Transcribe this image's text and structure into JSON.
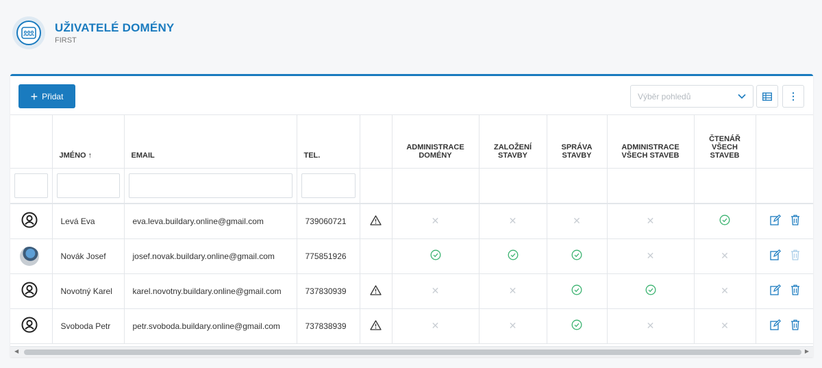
{
  "header": {
    "title": "UŽIVATELÉ DOMÉNY",
    "subtitle": "FIRST",
    "icon": "team-icon"
  },
  "toolbar": {
    "add_label": "Přidat",
    "view_placeholder": "Výběr pohledů"
  },
  "colors": {
    "accent": "#1a7bbf",
    "success": "#3cb371",
    "muted": "#c9ced4"
  },
  "columns": [
    {
      "key": "avatar",
      "label": ""
    },
    {
      "key": "name",
      "label": "JMÉNO ↑"
    },
    {
      "key": "email",
      "label": "EMAIL"
    },
    {
      "key": "tel",
      "label": "TEL."
    },
    {
      "key": "warn",
      "label": ""
    },
    {
      "key": "admin_domeny",
      "label": "ADMINISTRACE DOMÉNY"
    },
    {
      "key": "zalozeni",
      "label": "ZALOŽENÍ STAVBY"
    },
    {
      "key": "sprava",
      "label": "SPRÁVA STAVBY"
    },
    {
      "key": "admin_vsech",
      "label": "ADMINISTRACE VŠECH STAVEB"
    },
    {
      "key": "ctenar",
      "label": "ČTENÁŘ VŠECH STAVEB"
    },
    {
      "key": "actions",
      "label": ""
    }
  ],
  "rows": [
    {
      "name": "Levá Eva",
      "email": "eva.leva.buildary.online@gmail.com",
      "tel": "739060721",
      "warning": true,
      "avatar": "user-icon",
      "perms": [
        false,
        false,
        false,
        false,
        true
      ],
      "delete_enabled": true
    },
    {
      "name": "Novák Josef",
      "email": "josef.novak.buildary.online@gmail.com",
      "tel": "775851926",
      "warning": false,
      "avatar": "photo",
      "perms": [
        true,
        true,
        true,
        false,
        false
      ],
      "delete_enabled": false
    },
    {
      "name": "Novotný Karel",
      "email": "karel.novotny.buildary.online@gmail.com",
      "tel": "737830939",
      "warning": true,
      "avatar": "user-icon",
      "perms": [
        false,
        false,
        true,
        true,
        false
      ],
      "delete_enabled": true
    },
    {
      "name": "Svoboda Petr",
      "email": "petr.svoboda.buildary.online@gmail.com",
      "tel": "737838939",
      "warning": true,
      "avatar": "user-icon",
      "perms": [
        false,
        false,
        true,
        false,
        false
      ],
      "delete_enabled": true
    }
  ]
}
